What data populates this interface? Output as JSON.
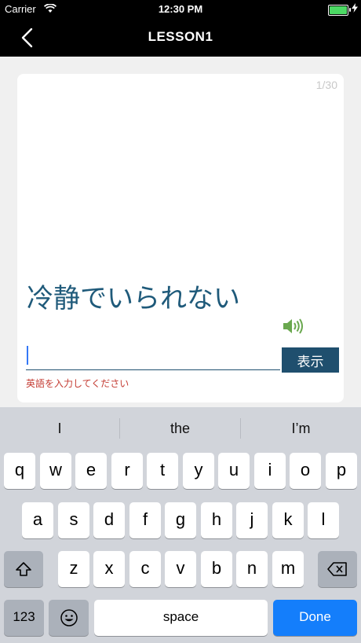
{
  "status_bar": {
    "carrier": "Carrier",
    "time": "12:30 PM"
  },
  "nav": {
    "title": "LESSON1"
  },
  "card": {
    "counter": "1/30",
    "prompt": "冷静でいられない",
    "input_value": "",
    "show_button": "表示",
    "hint": "英語を入力してください"
  },
  "keyboard": {
    "suggestions": [
      "I",
      "the",
      "I’m"
    ],
    "row1": [
      "q",
      "w",
      "e",
      "r",
      "t",
      "y",
      "u",
      "i",
      "o",
      "p"
    ],
    "row2": [
      "a",
      "s",
      "d",
      "f",
      "g",
      "h",
      "j",
      "k",
      "l"
    ],
    "row3": [
      "z",
      "x",
      "c",
      "v",
      "b",
      "n",
      "m"
    ],
    "numbers_key": "123",
    "space_key": "space",
    "done_key": "Done"
  },
  "colors": {
    "accent": "#1f4f6e",
    "prompt": "#1f5a7a",
    "hint": "#c43b32",
    "done": "#147efb"
  }
}
